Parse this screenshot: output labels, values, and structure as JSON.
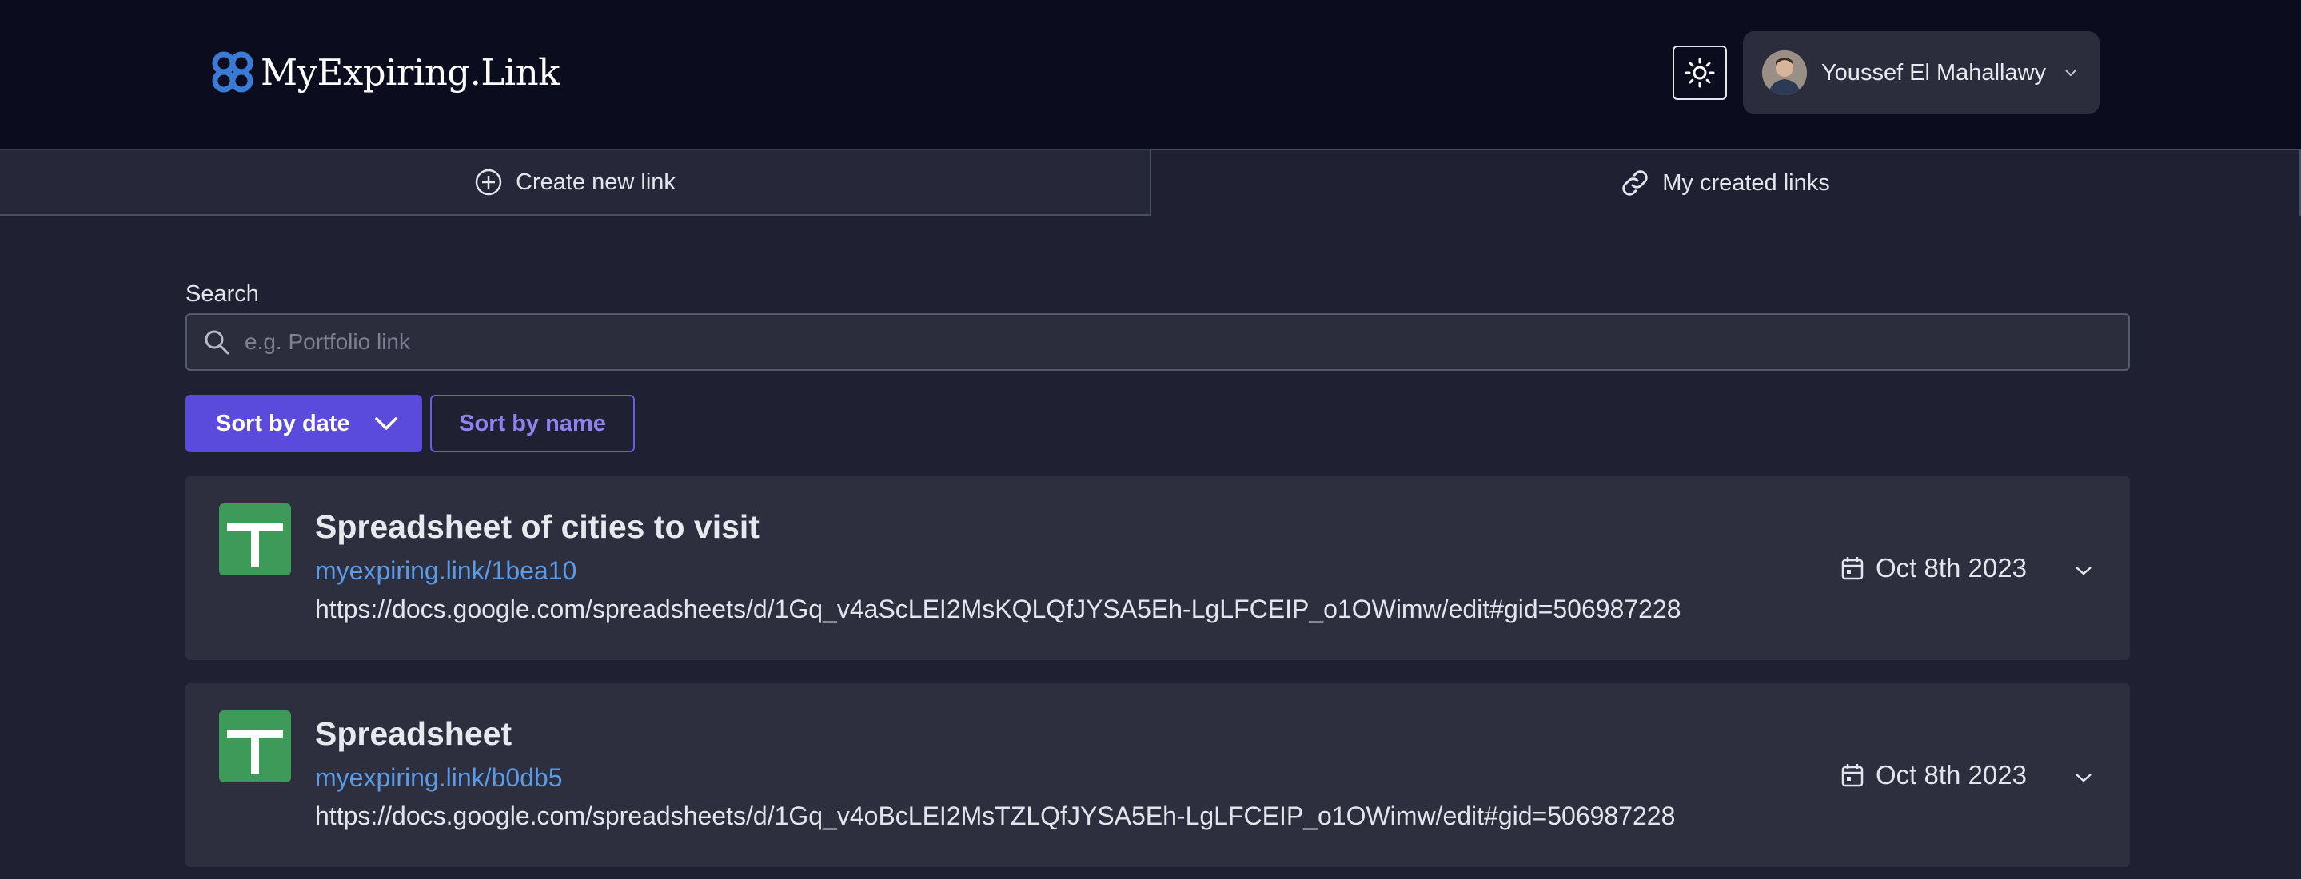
{
  "header": {
    "logo_text": "MyExpiring.Link",
    "theme_toggle_icon": "sun-icon",
    "user": {
      "name": "Youssef El Mahallawy"
    }
  },
  "tabs": [
    {
      "label": "Create new link",
      "icon": "plus-circle-icon",
      "active": false
    },
    {
      "label": "My created links",
      "icon": "link-icon",
      "active": true
    }
  ],
  "search": {
    "label": "Search",
    "placeholder": "e.g. Portfolio link",
    "value": ""
  },
  "sort": {
    "date_label": "Sort by date",
    "name_label": "Sort by name",
    "active": "date"
  },
  "links": [
    {
      "title": "Spreadsheet of cities to visit",
      "short_url": "myexpiring.link/1bea10",
      "long_url": "https://docs.google.com/spreadsheets/d/1Gq_v4aScLEI2MsKQLQfJYSA5Eh-LgLFCEIP_o1OWimw/edit#gid=506987228",
      "date": "Oct 8th 2023",
      "icon": "google-sheets-icon"
    },
    {
      "title": "Spreadsheet",
      "short_url": "myexpiring.link/b0db5",
      "long_url": "https://docs.google.com/spreadsheets/d/1Gq_v4oBcLEI2MsTZLQfJYSA5Eh-LgLFCEIP_o1OWimw/edit#gid=506987228",
      "date": "Oct 8th 2023",
      "icon": "google-sheets-icon"
    }
  ],
  "colors": {
    "header_bg": "#0b0c1d",
    "page_bg": "#1f2031",
    "card_bg": "#2d2e3e",
    "accent": "#5b4bdc",
    "link": "#5a9be8",
    "sheets_green": "#3e9a58"
  }
}
